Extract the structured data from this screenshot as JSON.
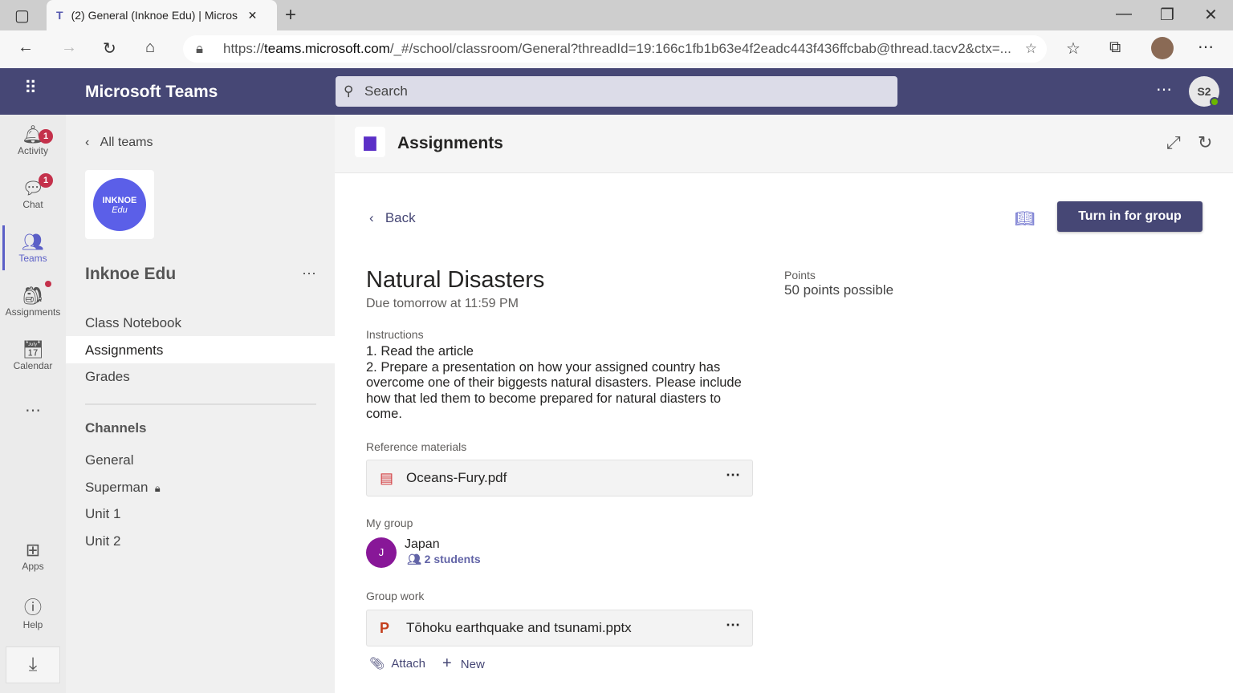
{
  "browser": {
    "tab_title": "(2) General (Inknoe Edu) | Micros",
    "url_domain": "teams.microsoft.com",
    "url_prefix": "https://",
    "url_rest": "/_#/school/classroom/General?threadId=19:166c1fb1b63e4f2eadc443f436ffcbab@thread.tacv2&ctx=..."
  },
  "header": {
    "app_name": "Microsoft Teams",
    "search_placeholder": "Search",
    "avatar_initials": "S2"
  },
  "rail": [
    {
      "label": "Activity",
      "badge": "1"
    },
    {
      "label": "Chat",
      "badge": "1"
    },
    {
      "label": "Teams"
    },
    {
      "label": "Assignments"
    },
    {
      "label": "Calendar"
    },
    {
      "label": "Apps"
    },
    {
      "label": "Help"
    }
  ],
  "team": {
    "back": "All teams",
    "logo_line1": "INKNOE",
    "logo_line2": "Edu",
    "name": "Inknoe Edu",
    "items": [
      "Class Notebook",
      "Assignments",
      "Grades"
    ],
    "channels_title": "Channels",
    "channels": [
      "General",
      "Superman",
      "Unit 1",
      "Unit 2"
    ]
  },
  "main": {
    "title": "Assignments",
    "back": "Back",
    "turn_in": "Turn in for group",
    "assignment_title": "Natural Disasters",
    "due": "Due tomorrow at 11:59 PM",
    "points_label": "Points",
    "points_value": "50 points possible",
    "instructions_label": "Instructions",
    "instr1": "1. Read the article",
    "instr2": "2. Prepare a presentation on how your assigned country has overcome one of their biggests natural disasters. Please include how that led them to become prepared for natural diasters to come.",
    "ref_label": "Reference materials",
    "ref_file": "Oceans-Fury.pdf",
    "group_label": "My group",
    "group_initial": "J",
    "group_name": "Japan",
    "group_count": "2 students",
    "work_label": "Group work",
    "work_file": "Tōhoku earthquake and tsunami.pptx",
    "attach": "Attach",
    "new": "New"
  }
}
